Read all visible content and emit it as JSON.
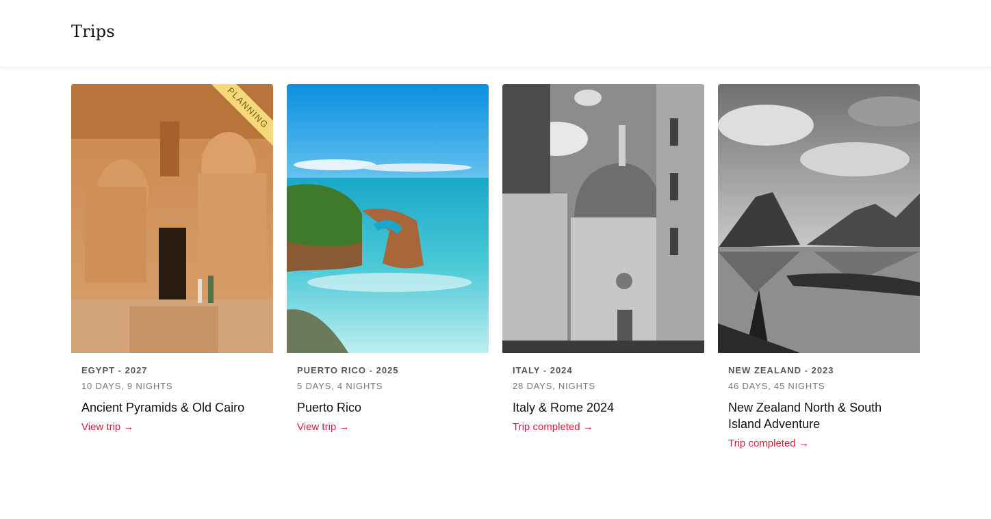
{
  "header": {
    "title": "Trips"
  },
  "trips": [
    {
      "location": "EGYPT - 2027",
      "duration": "10 DAYS, 9 NIGHTS",
      "name": "Ancient Pyramids & Old Cairo",
      "link": "View trip →",
      "badge": "PLANNING",
      "image": "temple-photo"
    },
    {
      "location": "PUERTO RICO - 2025",
      "duration": "5 DAYS, 4 NIGHTS",
      "name": "Puerto Rico",
      "link": "View trip →",
      "image": "beach-photo"
    },
    {
      "location": "ITALY - 2024",
      "duration": "28 DAYS, NIGHTS",
      "name": "Italy & Rome 2024",
      "link": "Trip completed →",
      "image": "cathedral-photo"
    },
    {
      "location": "NEW ZEALAND - 2023",
      "duration": "46 DAYS, 45 NIGHTS",
      "name": "New Zealand North & South Island Adventure",
      "link": "Trip completed →",
      "image": "fjord-photo"
    }
  ],
  "colors": {
    "accent": "#d71c3c",
    "badge": "#f5d979"
  }
}
